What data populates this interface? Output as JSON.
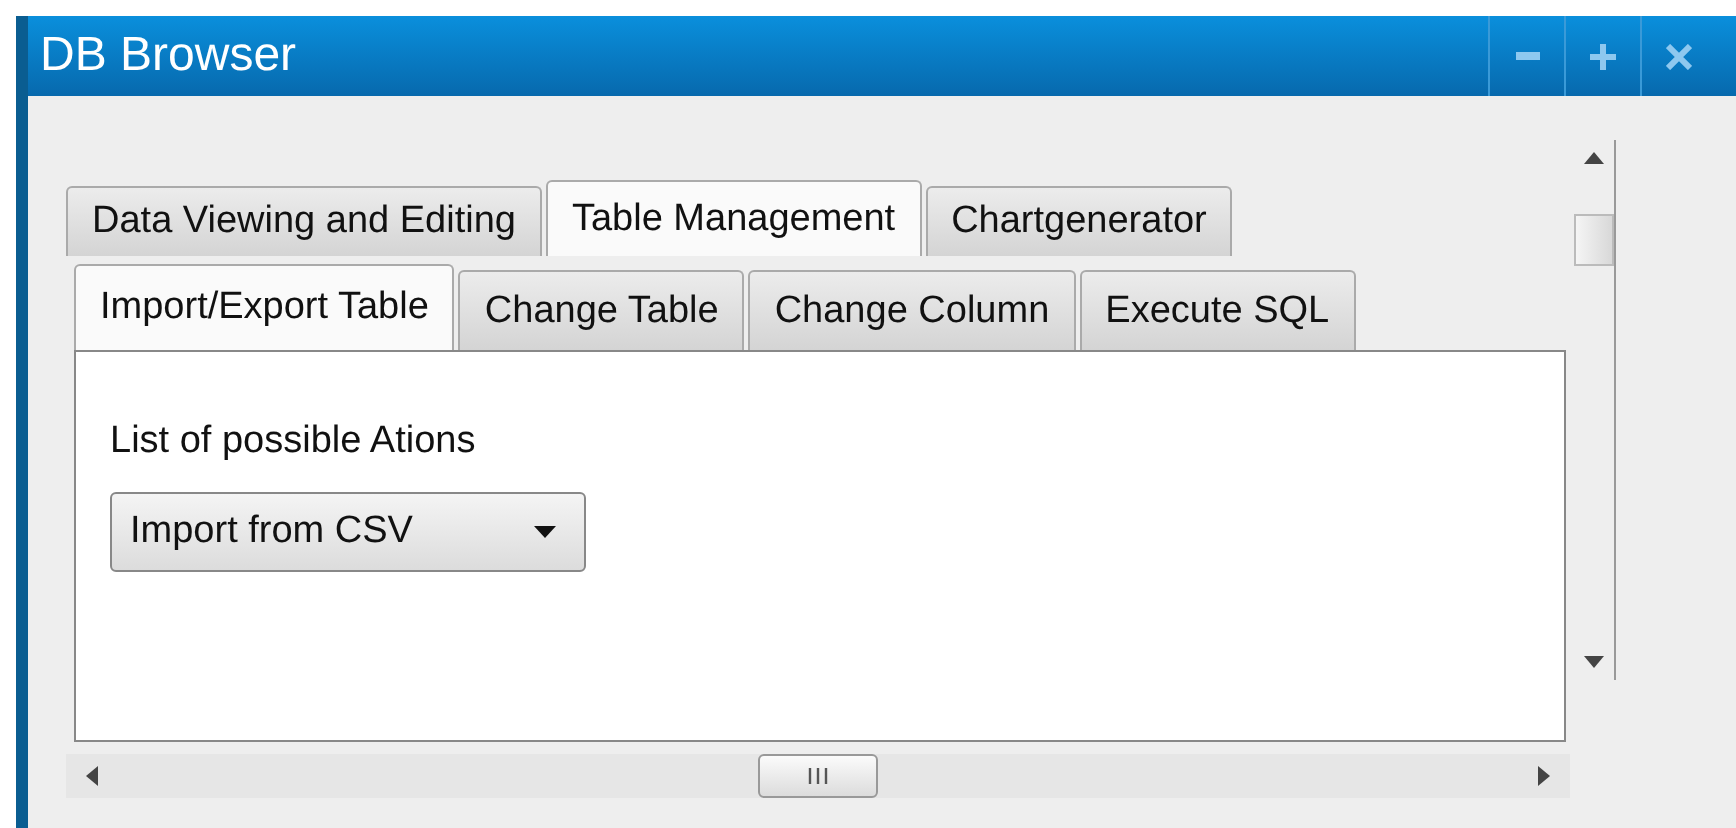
{
  "window": {
    "title": "DB Browser"
  },
  "window_controls": [
    {
      "kind": "minimize"
    },
    {
      "kind": "maximize"
    },
    {
      "kind": "close"
    }
  ],
  "tabs": [
    {
      "label": "Data Viewing and Editing",
      "selected": false
    },
    {
      "label": "Table Management",
      "selected": true
    },
    {
      "label": "Chartgenerator",
      "selected": false
    }
  ],
  "subtabs": [
    {
      "label": "Import/Export Table",
      "selected": true
    },
    {
      "label": "Change Table",
      "selected": false
    },
    {
      "label": "Change Column",
      "selected": false
    },
    {
      "label": "Execute SQL",
      "selected": false
    }
  ],
  "panel": {
    "label": "List of possible Ations",
    "dropdown": {
      "value": "Import from CSV"
    }
  }
}
